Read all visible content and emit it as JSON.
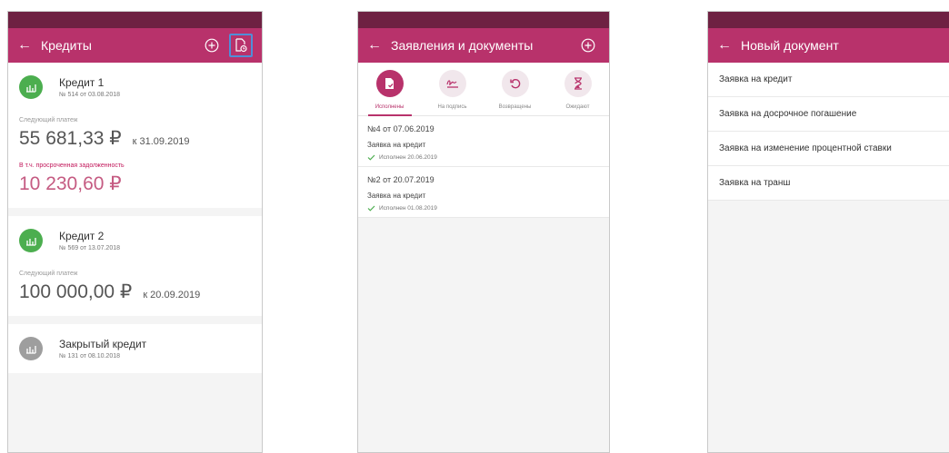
{
  "screen1": {
    "title": "Кредиты",
    "credits": [
      {
        "name": "Кредит 1",
        "number": "№ 514 от 03.08.2018",
        "next_label": "Следующий платеж",
        "next_amount": "55 681,33 ₽",
        "next_date": "к 31.09.2019",
        "overdue_label": "В т.ч. просроченная задолженность",
        "overdue_amount": "10 230,60 ₽"
      },
      {
        "name": "Кредит 2",
        "number": "№ 569 от 13.07.2018",
        "next_label": "Следующий платеж",
        "next_amount": "100 000,00 ₽",
        "next_date": "к 20.09.2019"
      },
      {
        "name": "Закрытый кредит",
        "number": "№ 131 от 08.10.2018"
      }
    ]
  },
  "screen2": {
    "title": "Заявления и документы",
    "tabs": [
      {
        "label": "Исполнены"
      },
      {
        "label": "На подпись"
      },
      {
        "label": "Возвращены"
      },
      {
        "label": "Ожидают"
      }
    ],
    "documents": [
      {
        "title": "№4 от 07.06.2019",
        "type": "Заявка на кредит",
        "status": "Исполнен 20.06.2019"
      },
      {
        "title": "№2 от 20.07.2019",
        "type": "Заявка на кредит",
        "status": "Исполнен 01.08.2019"
      }
    ]
  },
  "screen3": {
    "title": "Новый документ",
    "items": [
      "Заявка на кредит",
      "Заявка на досрочное погашение",
      "Заявка на изменение процентной ставки",
      "Заявка на транш"
    ]
  },
  "colors": {
    "appbar": "#b8326b",
    "statusbar": "#6e2142",
    "accent": "#b8326b",
    "credit_active": "#4cae4f",
    "credit_closed": "#9e9e9e",
    "overdue": "#c55b82"
  },
  "icons": {
    "back": "arrow-left-icon",
    "add": "plus-circle-icon",
    "documents": "document-icon",
    "credit": "chart-icon",
    "status": "checkmark-icon"
  }
}
